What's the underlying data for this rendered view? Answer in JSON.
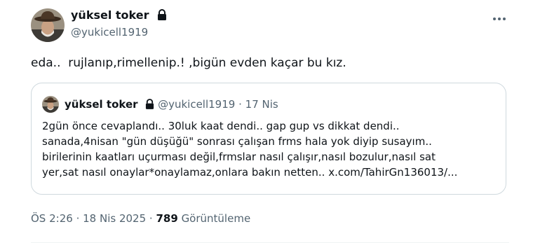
{
  "tweet": {
    "author": {
      "name": "yüksel toker",
      "handle": "@yukicell1919",
      "protected_icon": "lock-icon"
    },
    "more_icon": "more-dots-icon",
    "text": "eda..  rujlanıp,rimellenip.! ,bigün evden kaçar bu kız.",
    "time": "ÖS 2:26",
    "separator": "·",
    "date": "18 Nis 2025",
    "views_count": "789",
    "views_label": "Görüntüleme"
  },
  "quote": {
    "author": {
      "name": "yüksel toker",
      "handle": "@yukicell1919",
      "protected_icon": "lock-icon"
    },
    "separator": "·",
    "date": "17 Nis",
    "lines": [
      "2gün önce cevaplandı.. 30luk kaat dendi.. gap gup vs dikkat dendi..",
      "sanada,4nisan \"gün düşüğü\" sonrası çalışan frms hala yok diyip susayım..",
      "birilerinin kaatları uçurması değil,frmslar nasıl çalışır,nasıl bozulur,nasıl sat",
      "yer,sat nasıl onaylar*onaylamaz,onlara bakın netten.. x.com/TahirGn136013/..."
    ]
  },
  "colors": {
    "text": "#0f1419",
    "secondary": "#536471",
    "border": "#cfd9de"
  }
}
